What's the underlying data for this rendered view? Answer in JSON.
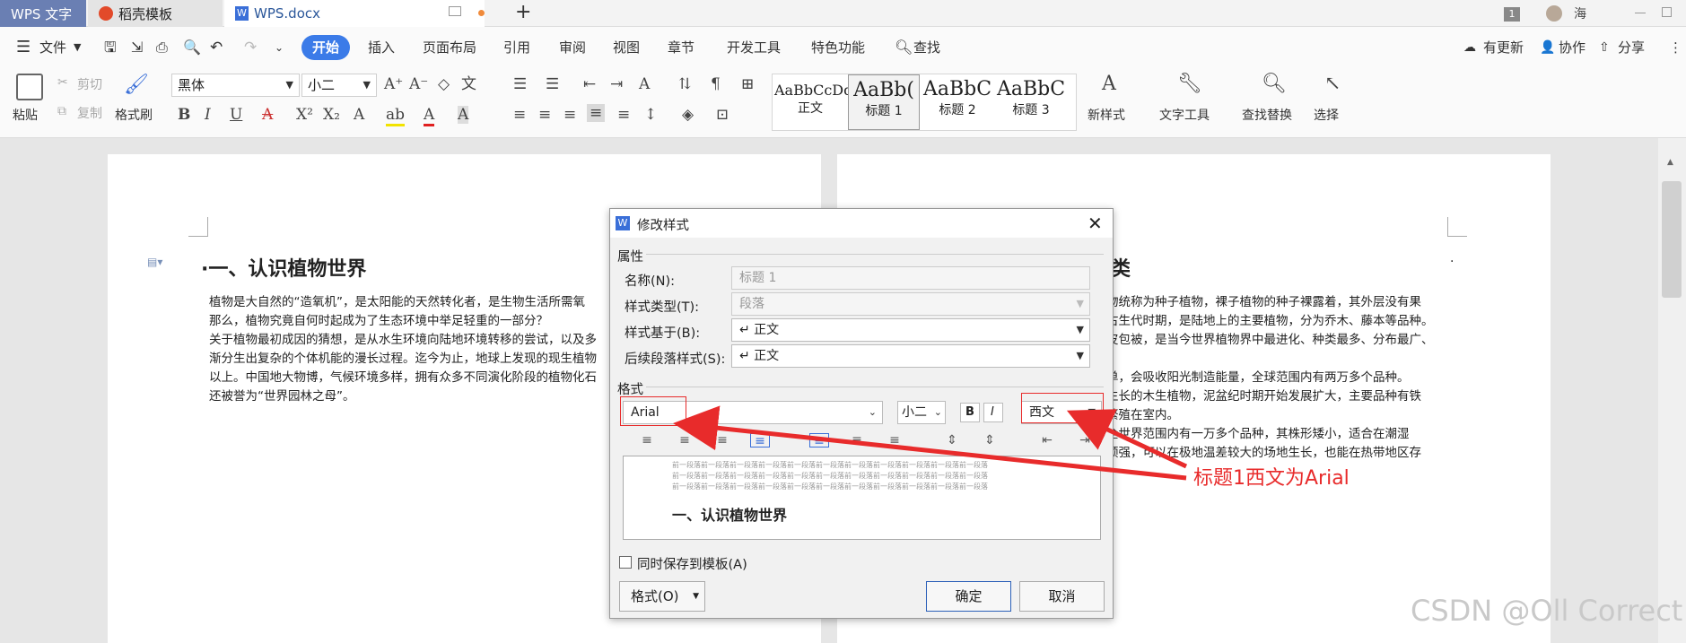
{
  "titlebar": {
    "tab_wps": "WPS 文字",
    "tab_docer": "稻壳模板",
    "tab_doc": "WPS.docx",
    "new_tab": "+",
    "page_badge": "1",
    "user_name": "海"
  },
  "menubar": {
    "file": "文件",
    "tabs": [
      "开始",
      "插入",
      "页面布局",
      "引用",
      "审阅",
      "视图",
      "章节",
      "开发工具",
      "特色功能"
    ],
    "search": "查找",
    "update": "有更新",
    "collab": "协作",
    "share": "分享"
  },
  "ribbon": {
    "paste": "粘贴",
    "cut": "剪切",
    "copy": "复制",
    "format_painter": "格式刷",
    "font_name": "黑体",
    "font_size": "小二",
    "styles": [
      {
        "sample": "AaBbCcDd",
        "label": "正文"
      },
      {
        "sample": "AaBb(",
        "label": "标题 1"
      },
      {
        "sample": "AaBbC",
        "label": "标题 2"
      },
      {
        "sample": "AaBbC",
        "label": "标题 3"
      }
    ],
    "new_style": "新样式",
    "text_tools": "文字工具",
    "find_replace": "查找替换",
    "select": "选择"
  },
  "document": {
    "left_heading": "·一、认识植物世界",
    "left_paragraphs": [
      "植物是大自然的“造氧机”，是太阳能的天然转化者，是生物生活所需氧",
      "那么，植物究竟自何时起成为了生态环境中举足轻重的一部分？",
      "关于植物最初成因的猜想，是从水生环境向陆地环境转移的尝试，以及多",
      "渐分生出复杂的个体机能的漫长过程。迄今为止，地球上发现的现生植物",
      "以上。中国地大物博，气候环境多样，拥有众多不同演化阶段的植物化石",
      "还被誉为“世界园林之母”。"
    ],
    "right_heading": "类",
    "right_paragraphs": [
      "物统称为种子植物，裸子植物的种子裸露着，其外层没有果",
      "古生代时期，是陆地上的主要植物，分为乔木、藤本等品种。",
      "皮包被，是当今世界植物界中最进化、种类最多、分布最广、",
      "",
      "单，会吸收阳光制造能量，全球范围内有两万多个品种。",
      "生长的木生植物，泥盆纪时期开始发展扩大，主要品种有铁",
      "繁殖在室内。",
      "全世界范围内有一万多个品种，其株形矮小，适合在潮湿",
      "顽强，可以在极地温差较大的场地生长，也能在热带地区存"
    ]
  },
  "dialog": {
    "title": "修改样式",
    "section_attributes": "属性",
    "name_label": "名称(N):",
    "name_value": "标题 1",
    "type_label": "样式类型(T):",
    "type_value": "段落",
    "based_label": "样式基于(B):",
    "based_value": "↵ 正文",
    "next_label": "后续段落样式(S):",
    "next_value": "↵ 正文",
    "section_format": "格式",
    "font_value": "Arial",
    "size_value": "小二",
    "bold": "B",
    "italic": "I",
    "script_value": "西文",
    "preview_filler": "前一段落前一段落前一段落前一段落前一段落前一段落前一段落前一段落前一段落前一段落前一段落",
    "preview_heading": "一、认识植物世界",
    "save_to_template": "同时保存到模板(A)",
    "format_button": "格式(O)",
    "ok": "确定",
    "cancel": "取消"
  },
  "annotation": "标题1西文为Arial",
  "watermark": "CSDN @Oll Correct"
}
